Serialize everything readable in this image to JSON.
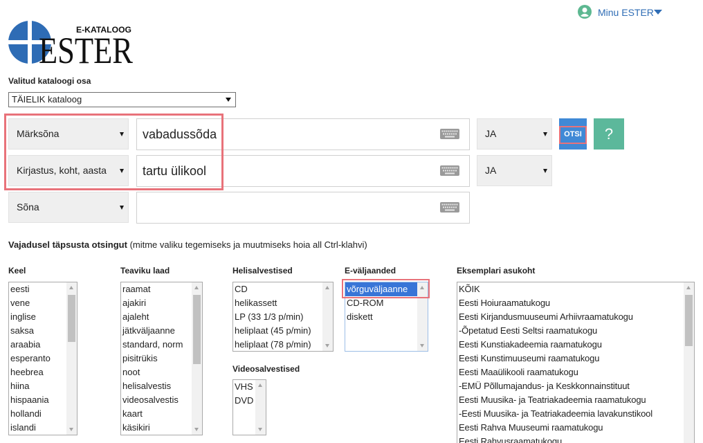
{
  "header": {
    "user_menu_label": "Minu ESTER"
  },
  "logo": {
    "subtitle": "E-KATALOOG",
    "title": "ESTER"
  },
  "catalog": {
    "label": "Valitud kataloogi osa",
    "selected": "TÄIELIK kataloog"
  },
  "search": {
    "rows": [
      {
        "field": "Märksõna",
        "value": "vabadussõda",
        "operator": "JA"
      },
      {
        "field": "Kirjastus, koht, aasta",
        "value": "tartu ülikool",
        "operator": "JA"
      },
      {
        "field": "Sõna",
        "value": ""
      }
    ],
    "search_button": "OTSI",
    "help_button": "?"
  },
  "refine": {
    "heading": "Vajadusel täpsusta otsingut",
    "hint": "(mitme valiku tegemiseks ja muutmiseks hoia all Ctrl-klahvi)"
  },
  "filters": {
    "language": {
      "label": "Keel",
      "options": [
        "eesti",
        "vene",
        "inglise",
        "saksa",
        "araabia",
        "esperanto",
        "heebrea",
        "hiina",
        "hispaania",
        "hollandi",
        "islandi"
      ]
    },
    "material_type": {
      "label": "Teaviku laad",
      "options": [
        "raamat",
        "ajakiri",
        "ajaleht",
        "jätkväljaanne",
        "standard, norm",
        "pisitrükis",
        "noot",
        "helisalvestis",
        "videosalvestis",
        "kaart",
        "käsikiri"
      ]
    },
    "sound_recordings": {
      "label": "Helisalvestised",
      "options": [
        "CD",
        "helikassett",
        "LP (33 1/3 p/min)",
        "heliplaat (45 p/min)",
        "heliplaat (78 p/min)"
      ]
    },
    "video_recordings": {
      "label": "Videosalvestised",
      "options": [
        "VHS",
        "DVD"
      ]
    },
    "e_publications": {
      "label": "E-väljaanded",
      "options": [
        "võrguväljaanne",
        "CD-ROM",
        "diskett"
      ],
      "selected": "võrguväljaanne"
    },
    "copy_location": {
      "label": "Eksemplari asukoht",
      "options": [
        "KÕIK",
        "Eesti Hoiuraamatukogu",
        "Eesti Kirjandusmuuseumi Arhiivraamatukogu",
        "-Õpetatud Eesti Seltsi raamatukogu",
        "Eesti Kunstiakadeemia raamatukogu",
        "Eesti Kunstimuuseumi raamatukogu",
        "Eesti Maaülikooli raamatukogu",
        "-EMÜ Põllumajandus- ja Keskkonnainstituut",
        "Eesti Muusika- ja Teatriakadeemia raamatukogu",
        "-Eesti Muusika- ja Teatriakadeemia lavakunstikool",
        "Eesti Rahva Muuseumi raamatukogu",
        "Eesti Rahvusraamatukogu"
      ]
    }
  },
  "icons": {
    "user": "user-icon",
    "menu_caret": "caret-down-icon",
    "keyboard": "keyboard-icon",
    "logo_mark": "logo-globe-icon"
  },
  "colors": {
    "link_blue": "#2f6db5",
    "logo_blue": "#2e6cb5",
    "search_button": "#4089d6",
    "help_button": "#5cb89b",
    "user_icon": "#5db891",
    "select_bg": "#efefef",
    "selected_option": "#3875d7",
    "highlight": "#e8727a"
  }
}
